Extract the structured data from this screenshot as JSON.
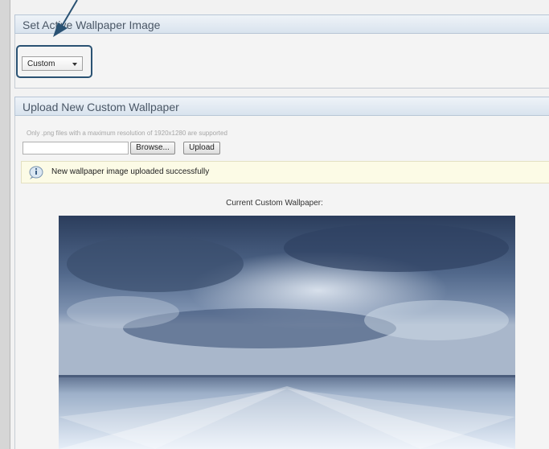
{
  "wallpaper_panel": {
    "title": "Set Active Wallpaper Image",
    "select_value": "Custom"
  },
  "upload_panel": {
    "title": "Upload New Custom Wallpaper",
    "note": "Only .png files with a maximum resolution of 1920x1280 are supported",
    "browse_label": "Browse...",
    "upload_label": "Upload",
    "success_message": "New wallpaper image uploaded successfully",
    "current_caption": "Current Custom Wallpaper:"
  },
  "icons": {
    "arrow": "annotation-arrow-icon",
    "message": "info-icon",
    "dropdown": "chevron-down-icon"
  },
  "colors": {
    "header_text": "#4a5766",
    "highlight_border": "#2a5273",
    "message_bg": "#fcfbe6"
  }
}
